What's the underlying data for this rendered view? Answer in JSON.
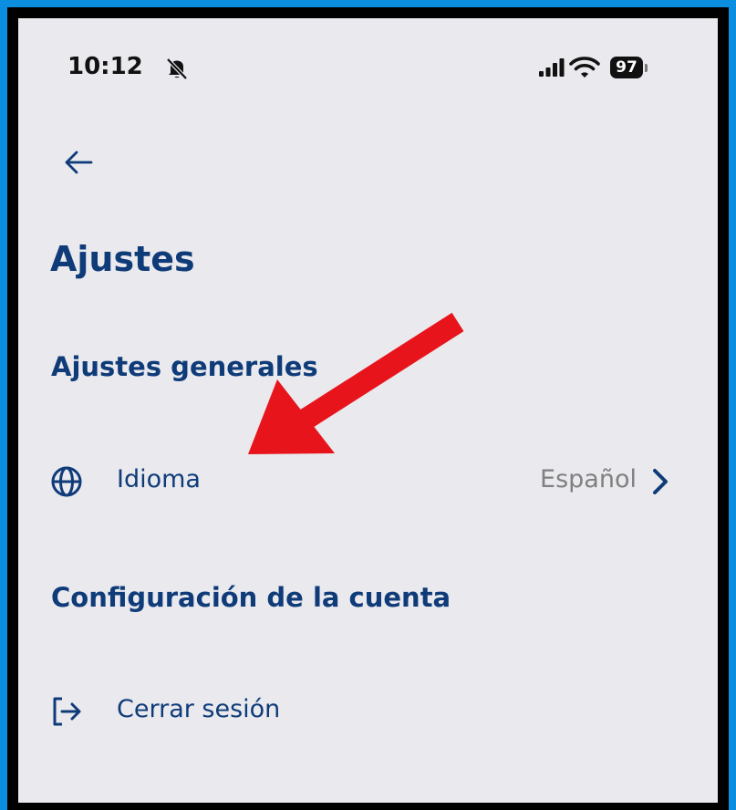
{
  "status_bar": {
    "time": "10:12",
    "battery": "97",
    "icons": [
      "bell-slash-icon",
      "signal-icon",
      "wifi-icon",
      "battery-icon"
    ]
  },
  "nav": {
    "back_icon": "arrow-left-icon"
  },
  "page": {
    "title": "Ajustes"
  },
  "general_settings": {
    "heading": "Ajustes generales",
    "language_row": {
      "icon": "globe-icon",
      "label": "Idioma",
      "value": "Español",
      "chevron": "chevron-right-icon"
    }
  },
  "account_settings": {
    "heading": "Configuración de la cuenta",
    "logout_row": {
      "icon": "logout-icon",
      "label": "Cerrar sesión"
    }
  },
  "annotation": {
    "color": "#e8141c",
    "points_to": "language_row"
  },
  "colors": {
    "frame": "#0a8fe0",
    "screen_bg": "#e9e9ee",
    "primary_text": "#0f3c79",
    "secondary_text": "#808080"
  }
}
